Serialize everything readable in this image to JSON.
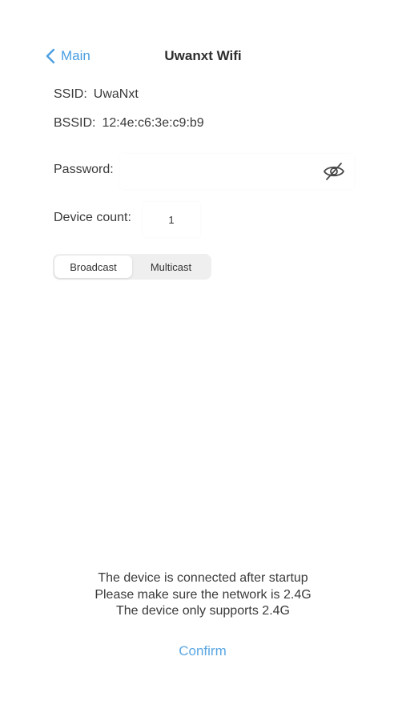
{
  "nav": {
    "back_label": "Main",
    "title": "Uwanxt Wifi"
  },
  "ssid": {
    "label": "SSID:",
    "value": "UwaNxt"
  },
  "bssid": {
    "label": "BSSID:",
    "value": "12:4e:c6:3e:c9:b9"
  },
  "password": {
    "label": "Password:",
    "value": "",
    "toggle_icon": "eye-slash-icon"
  },
  "device_count": {
    "label": "Device count:",
    "value": "1"
  },
  "mode": {
    "options": [
      "Broadcast",
      "Multicast"
    ],
    "selected": "Broadcast"
  },
  "messages": [
    "The device is connected after startup",
    "Please make sure the network is 2.4G",
    "The device only supports 2.4G"
  ],
  "confirm_label": "Confirm",
  "colors": {
    "accent": "#4a9ee0",
    "text": "#3a3a3a",
    "segment_bg": "#efefef"
  }
}
